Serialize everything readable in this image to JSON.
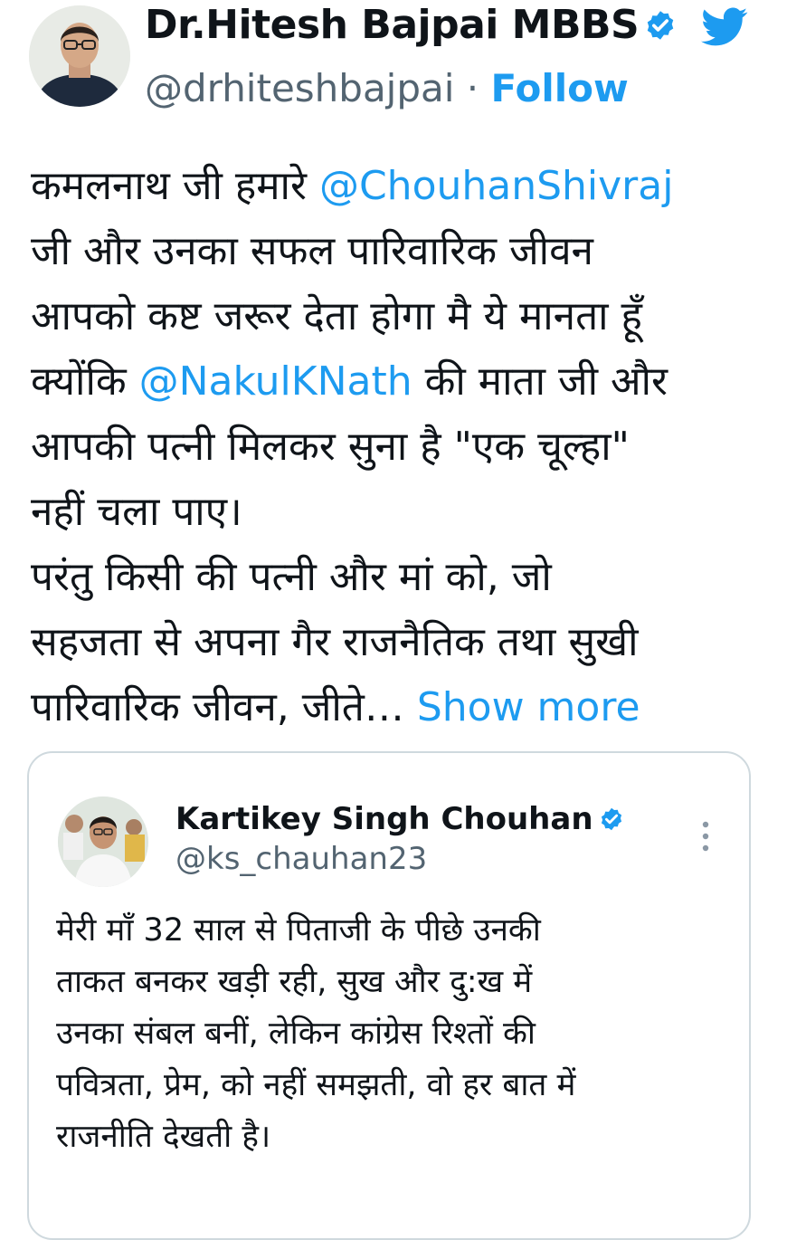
{
  "tweet": {
    "author_name": "Dr.Hitesh Bajpai MBBS",
    "author_handle": "@drhiteshbajpai",
    "separator": " · ",
    "follow_label": "Follow",
    "lines": [
      [
        "कमलनाथ जी हमारे ",
        "@ChouhanShivraj"
      ],
      [
        "जी और उनका सफल पारिवारिक जीवन"
      ],
      [
        "आपको कष्ट जरूर देता होगा मै ये मानता हूँ"
      ],
      [
        "क्योंकि ",
        "@NakulKNath",
        " की माता जी और"
      ],
      [
        "आपकी पत्नी मिलकर सुना है \"एक चूल्हा\""
      ],
      [
        "नहीं चला पाए।"
      ],
      [
        "परंतु किसी की पत्नी और मां को, जो"
      ],
      [
        "सहजता से अपना गैर राजनैतिक तथा सुखी"
      ],
      [
        "पारिवारिक जीवन, जीते… ",
        "Show more"
      ]
    ]
  },
  "quoted_tweet": {
    "author_name": "Kartikey Singh Chouhan",
    "author_handle": "@ks_chauhan23",
    "lines": [
      "मेरी माँ 32 साल से पिताजी के पीछे उनकी",
      "ताकत बनकर खड़ी रही, सुख और दु:ख में",
      "उनका संबल बनीं, लेकिन कांग्रेस रिश्तों की",
      "पवित्रता, प्रेम, को नहीं समझती, वो हर बात में",
      "राजनीति देखती है।"
    ]
  },
  "icons": {
    "verified": "verified-badge-icon",
    "brand": "twitter-bird-icon",
    "more": "more-options-icon"
  },
  "colors": {
    "accent": "#1d9bf0",
    "text": "#0f1419",
    "secondary_text": "#536471",
    "border": "#cfd9de"
  }
}
